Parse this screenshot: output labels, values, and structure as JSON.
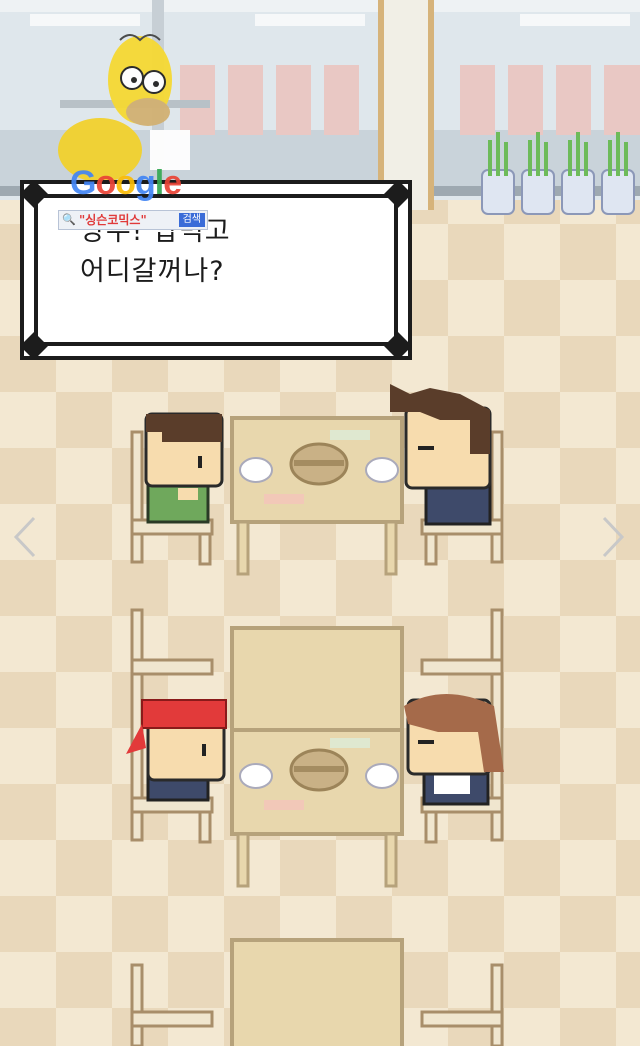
{
  "dialog": {
    "text": "낭수! 밥먹고\n어디갈꺼나?"
  },
  "watermark": {
    "logo": "Google",
    "logo_colors": [
      "#4285f4",
      "#ea4335",
      "#fbbc05",
      "#4285f4",
      "#34a853",
      "#ea4335"
    ],
    "search_query": "\"싱슨코믹스\"",
    "search_button": "검색"
  },
  "navigation": {
    "prev_icon": "chevron-left-icon",
    "next_icon": "chevron-right-icon"
  },
  "colors": {
    "floor_light": "#f3e8d2",
    "floor_dark": "#e6d3b3",
    "table": "#e8d7ad",
    "table_edge": "#b6a27b",
    "chair": "#f0e6cf",
    "wall": "#dde5ea",
    "dialog_border": "#1c1c1c"
  }
}
